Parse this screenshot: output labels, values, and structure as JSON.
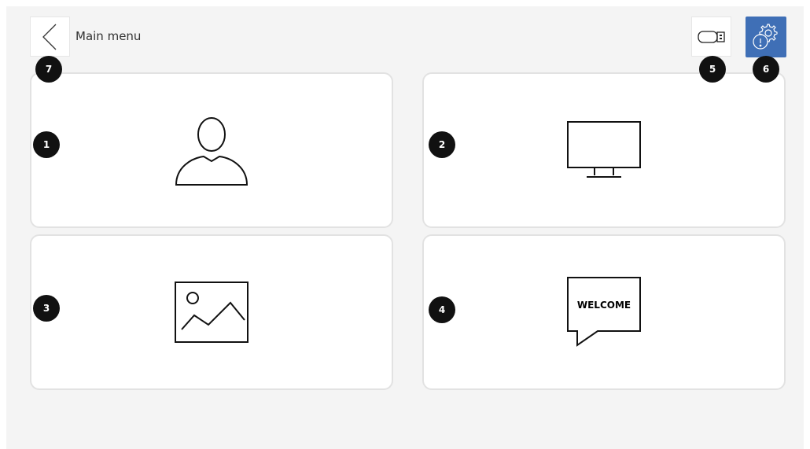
{
  "header": {
    "title": "Main menu",
    "back_icon": "chevron-left-icon",
    "usb_icon": "usb-drive-icon",
    "settings_icon": "settings-info-icon",
    "settings_bg": "#3f6fb6"
  },
  "tiles": [
    {
      "icon": "user-icon"
    },
    {
      "icon": "monitor-icon"
    },
    {
      "icon": "image-icon"
    },
    {
      "icon": "welcome-message-icon",
      "text": "WELCOME"
    }
  ],
  "badges": [
    "1",
    "2",
    "3",
    "4",
    "5",
    "6",
    "7"
  ]
}
